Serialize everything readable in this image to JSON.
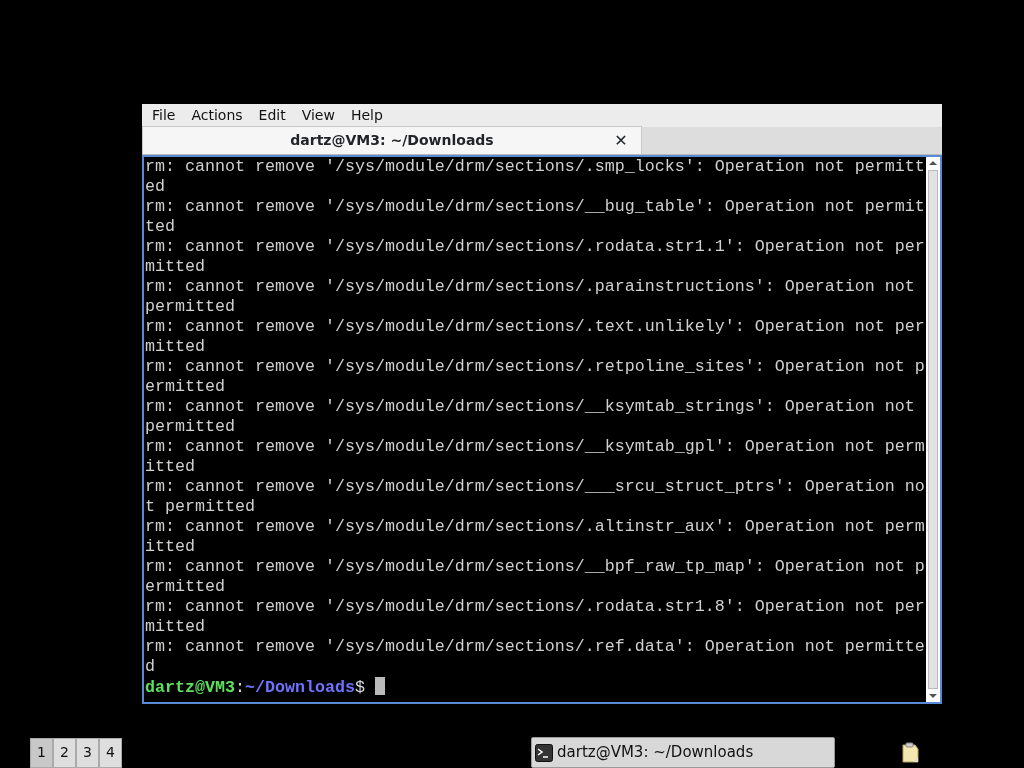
{
  "window": {
    "menu": [
      "File",
      "Actions",
      "Edit",
      "View",
      "Help"
    ],
    "tabs": [
      {
        "title": "dartz@VM3: ~/Downloads",
        "selected": true,
        "close": "✕"
      }
    ],
    "terminal": {
      "lines": [
        "rm: cannot remove '/sys/module/drm/sections/.smp_locks': Operation not permitted",
        "rm: cannot remove '/sys/module/drm/sections/__bug_table': Operation not permitted",
        "rm: cannot remove '/sys/module/drm/sections/.rodata.str1.1': Operation not permitted",
        "rm: cannot remove '/sys/module/drm/sections/.parainstructions': Operation not permitted",
        "rm: cannot remove '/sys/module/drm/sections/.text.unlikely': Operation not permitted",
        "rm: cannot remove '/sys/module/drm/sections/.retpoline_sites': Operation not permitted",
        "rm: cannot remove '/sys/module/drm/sections/__ksymtab_strings': Operation not permitted",
        "rm: cannot remove '/sys/module/drm/sections/__ksymtab_gpl': Operation not permitted",
        "rm: cannot remove '/sys/module/drm/sections/___srcu_struct_ptrs': Operation not permitted",
        "rm: cannot remove '/sys/module/drm/sections/.altinstr_aux': Operation not permitted",
        "rm: cannot remove '/sys/module/drm/sections/__bpf_raw_tp_map': Operation not permitted",
        "rm: cannot remove '/sys/module/drm/sections/.rodata.str1.8': Operation not permitted",
        "rm: cannot remove '/sys/module/drm/sections/.ref.data': Operation not permitted"
      ],
      "prompt": {
        "user": "dartz@VM3",
        "separator": ":",
        "path": "~/Downloads",
        "symbol": "$"
      }
    }
  },
  "taskbar": {
    "workspaces": [
      {
        "label": "1",
        "selected": true
      },
      {
        "label": "2",
        "selected": false
      },
      {
        "label": "3",
        "selected": false
      },
      {
        "label": "4",
        "selected": false
      }
    ],
    "tasks": [
      {
        "title": "dartz@VM3: ~/Downloads"
      }
    ]
  }
}
